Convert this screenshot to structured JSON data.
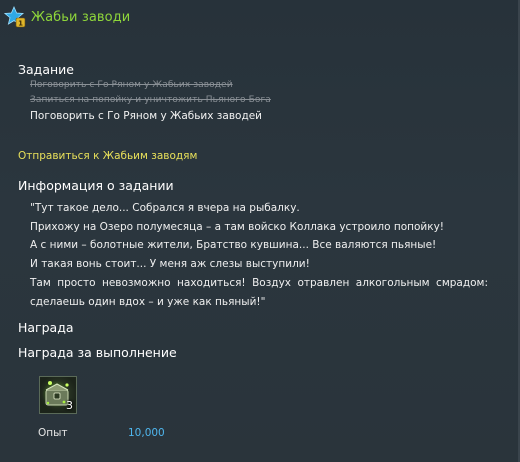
{
  "title": "Жабьи заводи",
  "task_section": {
    "heading": "Задание",
    "objectives_done": [
      "Поговорить с Го Ряном у Жабьих заводей",
      "Запиться на попойку и уничтожить Пьяного Бога"
    ],
    "objective_active": "Поговорить с Го Ряном у Жабьих заводей"
  },
  "goto_link": "Отправиться к Жабьим заводям",
  "info_section": {
    "heading": "Информация о задании",
    "lines": [
      "\"Тут такое дело... Собрался я вчера на рыбалку.",
      "Прихожу на Озеро полумесяца – а там войско Коллака устроило попойку!",
      "А с ними – болотные жители, Братство кувшина... Все валяются пьяные!",
      "И такая вонь стоит... У меня аж слезы выступили!",
      "Там просто невозможно находиться! Воздух отравлен алкогольным смрадом:",
      "сделаешь один вдох – и уже как пьяный!\""
    ]
  },
  "reward_section": {
    "heading": "Награда",
    "subheading": "Награда за выполнение",
    "item": {
      "icon": "green-chest-icon",
      "count": "3"
    },
    "exp_label": "Опыт",
    "exp_value": "10,000"
  },
  "colors": {
    "title": "#8fd63a",
    "link": "#e8e05a",
    "exp_value": "#4fb6ee",
    "done_objective": "#8a9096",
    "background": "#2a353d"
  }
}
